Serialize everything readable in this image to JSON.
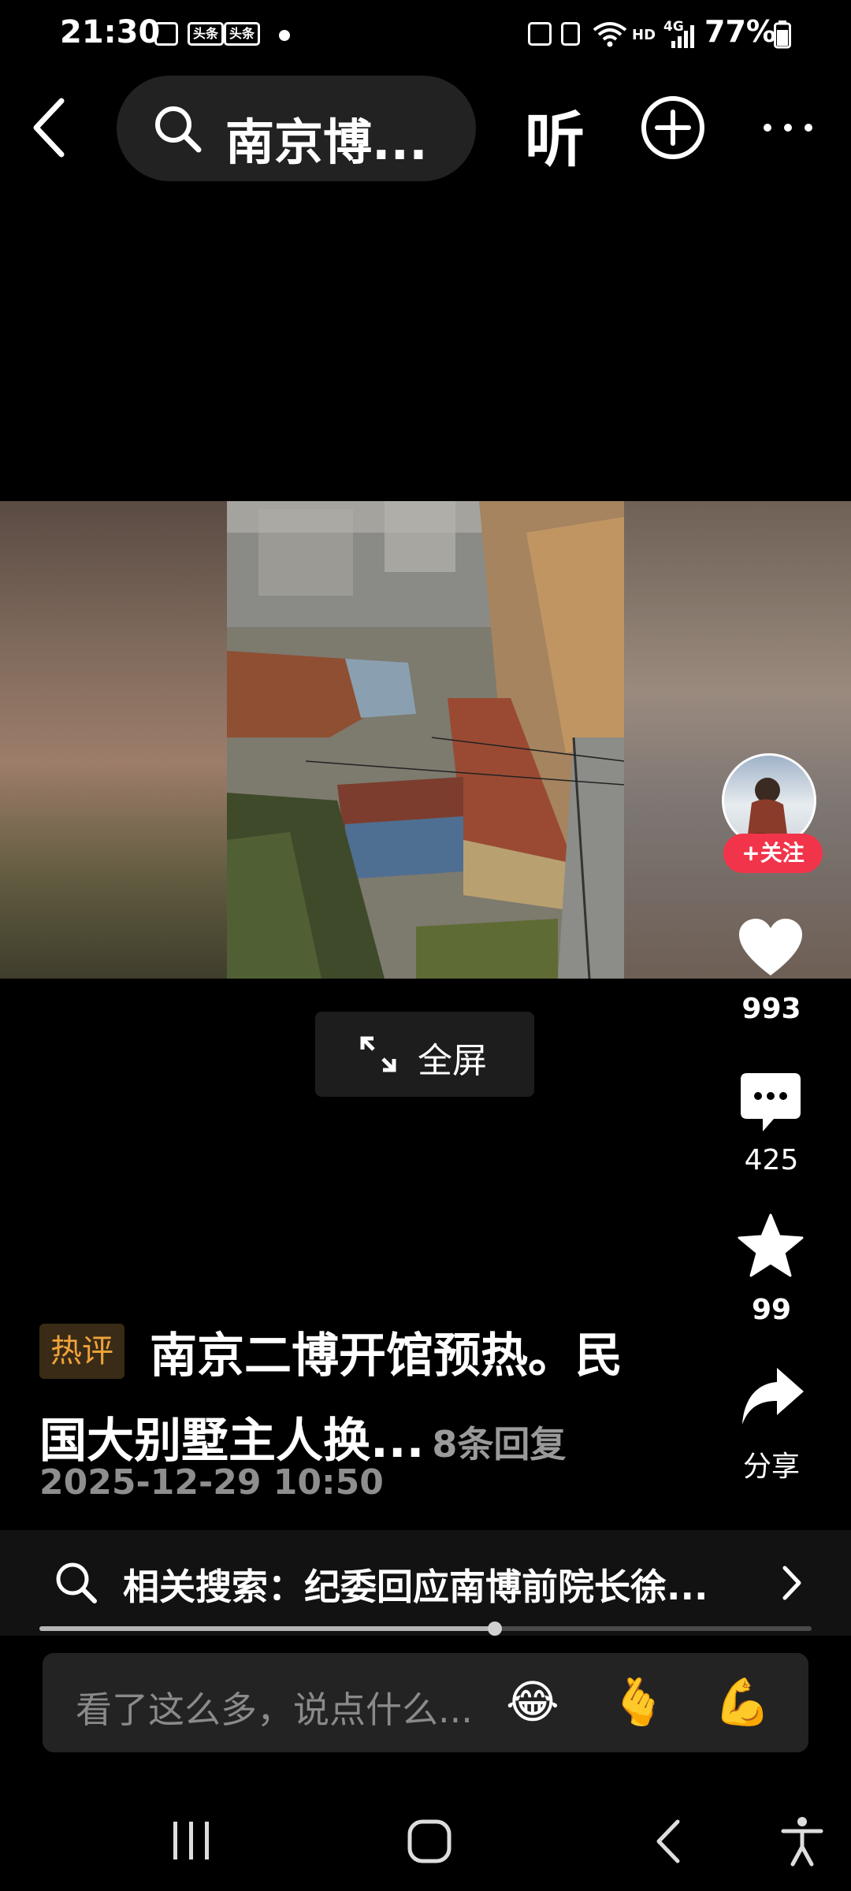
{
  "status_bar": {
    "time": "21:30",
    "app_badge_1": "头条",
    "app_badge_2": "头条",
    "network": "HD",
    "cell": "4G",
    "battery": "77%"
  },
  "top_bar": {
    "search_text": "南京博...",
    "listen_label": "听"
  },
  "fullscreen_label": "全屏",
  "right_rail": {
    "follow_label": "+关注",
    "likes": "993",
    "comments": "425",
    "favorites": "99",
    "share_label": "分享"
  },
  "caption": {
    "tag": "热评",
    "line1": "南京二博开馆预热。民",
    "line2": "国大别墅主人换...",
    "replies": "8条回复",
    "date": "2025-12-29 10:50"
  },
  "related": {
    "text": "相关搜索：纪委回应南博前院长徐..."
  },
  "progress": {
    "fraction": 0.59
  },
  "comment_bar": {
    "placeholder": "看了这么多，说点什么...",
    "emojis": [
      "😂",
      "🫰",
      "💪"
    ]
  },
  "colors": {
    "follow_red": "#f2344b",
    "tag_orange": "#f0a33a"
  },
  "icons": [
    "back-icon",
    "search-icon",
    "add-icon",
    "more-icon",
    "heart-icon",
    "comment-icon",
    "star-icon",
    "share-icon",
    "expand-icon",
    "chevron-right-icon",
    "recents-icon",
    "home-icon",
    "nav-back-icon",
    "accessibility-icon"
  ]
}
